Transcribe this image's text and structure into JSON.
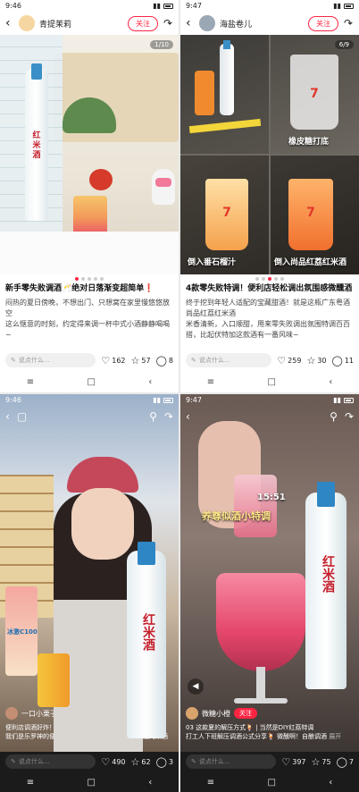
{
  "panels": [
    {
      "time": "9:46",
      "author": "青提茉莉",
      "follow": "关注",
      "counter": "1/10",
      "title": "新手零失败调酒🥂绝对日落渐变超简单❗",
      "body": [
        "闷热的夏日傍晚，不想出门、只想窝在家里慢悠悠放空",
        "这么惬意的时刻，约定得来调一杯中式小酒静静喝喝",
        "~"
      ],
      "comment_placeholder": "说点什么...",
      "likes": "162",
      "stars": "57",
      "comments": "8"
    },
    {
      "time": "9:47",
      "author": "海盐卷儿",
      "follow": "关注",
      "counter": "6/9",
      "captions": [
        "橡皮糖打底",
        "倒入番石榴汁",
        "倒入尚品红荔红米酒"
      ],
      "cup_brand": "7-ELEVEN",
      "title": "4款零失败特调！便利店轻松调出氛围感微醺酒",
      "body": [
        "终于挖到年轻人适配的宝藏甜酒！就是这瓶广东粤酒",
        "尚品红荔红米酒",
        "米香清新，入口顺甜，用来零失败调出氛围特调百百搭，比起伏特加这款酒有一番风味~"
      ],
      "comment_placeholder": "说点什么...",
      "likes": "259",
      "stars": "30",
      "comments": "11"
    },
    {
      "time": "9:46",
      "author": "一口小栗子",
      "follow": "关注",
      "caption_title": "便利店调酒好炸！🍹 灵梦嗨~红荔红米酒太好喝了",
      "caption_body": "我们是乐罗神的便利店买的调调酒给尚品红荔红米酒的米酒",
      "bottle_label": "红米酒",
      "drink_label": "冰激C100",
      "comment_placeholder": "说点什么...",
      "likes": "490",
      "stars": "62",
      "comments": "3"
    },
    {
      "time": "9:47",
      "author": "微糖小橙",
      "follow": "关注",
      "overlay_time": "15:51",
      "overlay_text": "养尊似酒小特调",
      "caption_title": "03 这款夏的解压方式🍹 | 当然是DIY红荔特调",
      "caption_body": "打工人下班解压调酒公式分享🍹 微醺啊！自酿调酒",
      "more": "展开",
      "bottle_label": "红米酒",
      "comment_placeholder": "说点什么...",
      "likes": "397",
      "stars": "75",
      "comments": "7"
    }
  ],
  "nav": {
    "menu": "≡",
    "home": "□",
    "back": "‹"
  },
  "colors": {
    "accent": "#ff2442"
  }
}
